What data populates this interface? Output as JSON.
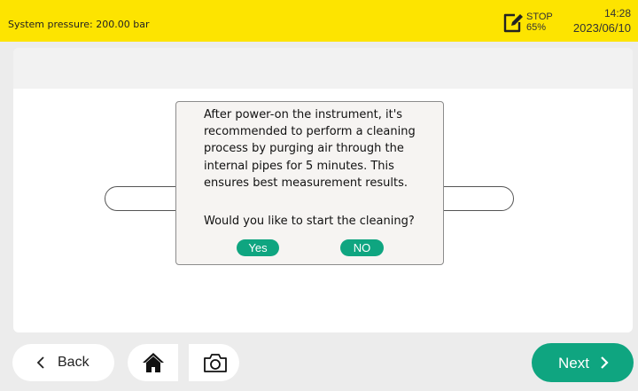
{
  "status_bar": {
    "pressure_text": "System pressure: 200.00 bar",
    "stop_label": "STOP",
    "battery_label": "65%",
    "time": "14:28",
    "date": "2023/06/10",
    "background_color": "#fde400"
  },
  "dialog": {
    "message": "After power-on the instrument, it's recommended to perform a cleaning process by purging air through the internal pipes for 5 minutes. This ensures best measurement results.",
    "question": "Would you like to start the cleaning?",
    "yes_label": "Yes",
    "no_label": "NO"
  },
  "nav": {
    "back_label": "Back",
    "next_label": "Next",
    "home_icon": "home-icon",
    "camera_icon": "camera-icon",
    "accent_color": "#0fa580"
  }
}
